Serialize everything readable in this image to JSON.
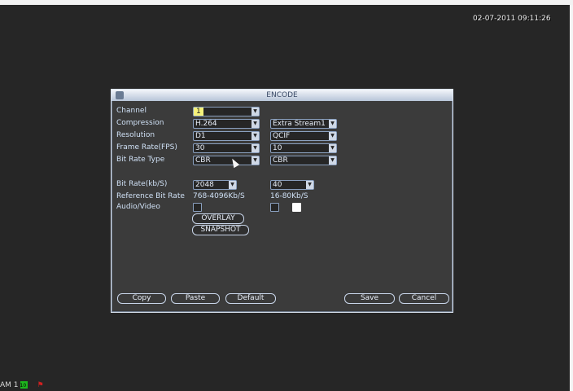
{
  "datetime": "02-07-2011 09:11:26",
  "status": {
    "text": "AM 1",
    "rec_badge": "10"
  },
  "dialog": {
    "title": "ENCODE",
    "labels": {
      "channel": "Channel",
      "compression": "Compression",
      "resolution": "Resolution",
      "frame_rate": "Frame Rate(FPS)",
      "bit_rate_type": "Bit Rate Type",
      "bit_rate": "Bit Rate(kb/S)",
      "reference_bit_rate": "Reference Bit Rate",
      "audio_video": "Audio/Video"
    },
    "main": {
      "channel": "1",
      "compression": "H.264",
      "resolution": "D1",
      "frame_rate": "30",
      "bit_rate_type": "CBR",
      "bit_rate": "2048",
      "reference_bit_rate": "768-4096Kb/S"
    },
    "extra": {
      "stream": "Extra Stream1",
      "resolution": "QCIF",
      "frame_rate": "10",
      "bit_rate_type": "CBR",
      "bit_rate": "40",
      "reference_bit_rate": "16-80Kb/S"
    },
    "overlay_label": "OVERLAY",
    "snapshot_label": "SNAPSHOT",
    "buttons": {
      "copy": "Copy",
      "paste": "Paste",
      "default": "Default",
      "save": "Save",
      "cancel": "Cancel"
    }
  }
}
